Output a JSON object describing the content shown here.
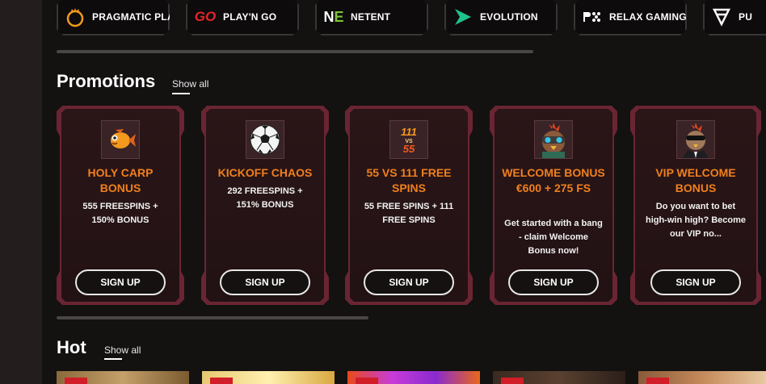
{
  "providers": [
    {
      "name": "PRAGMATIC PLAY",
      "icon": "pragmatic-play-logo-icon"
    },
    {
      "name": "PLAY'N GO",
      "icon": "playngo-logo-icon"
    },
    {
      "name": "NETENT",
      "icon": "netent-logo-icon"
    },
    {
      "name": "EVOLUTION",
      "icon": "evolution-logo-icon"
    },
    {
      "name": "RELAX GAMING",
      "icon": "relax-gaming-logo-icon"
    },
    {
      "name": "PU",
      "icon": "push-gaming-logo-icon"
    }
  ],
  "promotions": {
    "title": "Promotions",
    "show_all": "Show all",
    "cards": [
      {
        "title": "HOLY CARP BONUS",
        "desc": "555 FREESPINS + 150% BONUS",
        "button": "SIGN UP",
        "icon": "goldfish-icon"
      },
      {
        "title": "KICKOFF CHAOS",
        "desc": "292 FREESPINS + 151% BONUS",
        "button": "SIGN UP",
        "icon": "soccer-ball-icon"
      },
      {
        "title": "55 VS 111 FREE SPINS",
        "desc": "55 FREE SPINS + 111 FREE SPINS",
        "button": "SIGN UP",
        "icon": "111-vs-55-icon"
      },
      {
        "title": "WELCOME BONUS €600 + 275 FS",
        "desc": "Get started with a bang - claim Welcome Bonus now!",
        "button": "SIGN UP",
        "icon": "rooster-goggles-icon"
      },
      {
        "title": "VIP WELCOME BONUS",
        "desc": "Do you want to bet high-win high? Become our VIP no...",
        "button": "SIGN UP",
        "icon": "rooster-suit-icon"
      }
    ]
  },
  "hot": {
    "title": "Hot",
    "show_all": "Show all"
  },
  "colors": {
    "accent_orange": "#f0801e",
    "card_border": "#6a2532",
    "badge_red": "#d11e28"
  }
}
